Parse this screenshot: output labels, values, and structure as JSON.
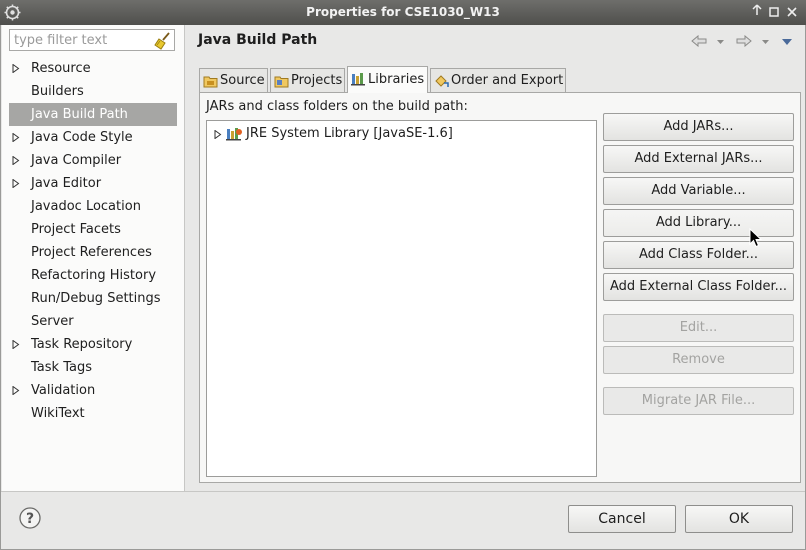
{
  "window": {
    "title": "Properties for CSE1030_W13"
  },
  "filter": {
    "placeholder": "type filter text"
  },
  "sidebar": {
    "items": [
      {
        "label": "Resource",
        "expandable": true
      },
      {
        "label": "Builders",
        "expandable": false
      },
      {
        "label": "Java Build Path",
        "expandable": false,
        "selected": true
      },
      {
        "label": "Java Code Style",
        "expandable": true
      },
      {
        "label": "Java Compiler",
        "expandable": true
      },
      {
        "label": "Java Editor",
        "expandable": true
      },
      {
        "label": "Javadoc Location",
        "expandable": false
      },
      {
        "label": "Project Facets",
        "expandable": false
      },
      {
        "label": "Project References",
        "expandable": false
      },
      {
        "label": "Refactoring History",
        "expandable": false
      },
      {
        "label": "Run/Debug Settings",
        "expandable": false
      },
      {
        "label": "Server",
        "expandable": false
      },
      {
        "label": "Task Repository",
        "expandable": true
      },
      {
        "label": "Task Tags",
        "expandable": false
      },
      {
        "label": "Validation",
        "expandable": true
      },
      {
        "label": "WikiText",
        "expandable": false
      }
    ]
  },
  "page": {
    "title": "Java Build Path"
  },
  "tabs": [
    {
      "label": "Source",
      "icon": "source-folder-icon"
    },
    {
      "label": "Projects",
      "icon": "projects-icon"
    },
    {
      "label": "Libraries",
      "icon": "libraries-icon",
      "active": true
    },
    {
      "label": "Order and Export",
      "icon": "order-export-icon"
    }
  ],
  "libraries": {
    "label": "JARs and class folders on the build path:",
    "entries": [
      {
        "label": "JRE System Library [JavaSE-1.6]",
        "icon": "jre-library-icon"
      }
    ]
  },
  "buttons": {
    "add_jars": "Add JARs...",
    "add_external_jars": "Add External JARs...",
    "add_variable": "Add Variable...",
    "add_library": "Add Library...",
    "add_class_folder": "Add Class Folder...",
    "add_external_class_folder": "Add External Class Folder...",
    "edit": "Edit...",
    "remove": "Remove",
    "migrate_jar": "Migrate JAR File..."
  },
  "footer": {
    "cancel": "Cancel",
    "ok": "OK"
  },
  "colors": {
    "titlebar": "#5b5b58",
    "selection": "#a6a6a4",
    "background": "#e8e8e7"
  }
}
